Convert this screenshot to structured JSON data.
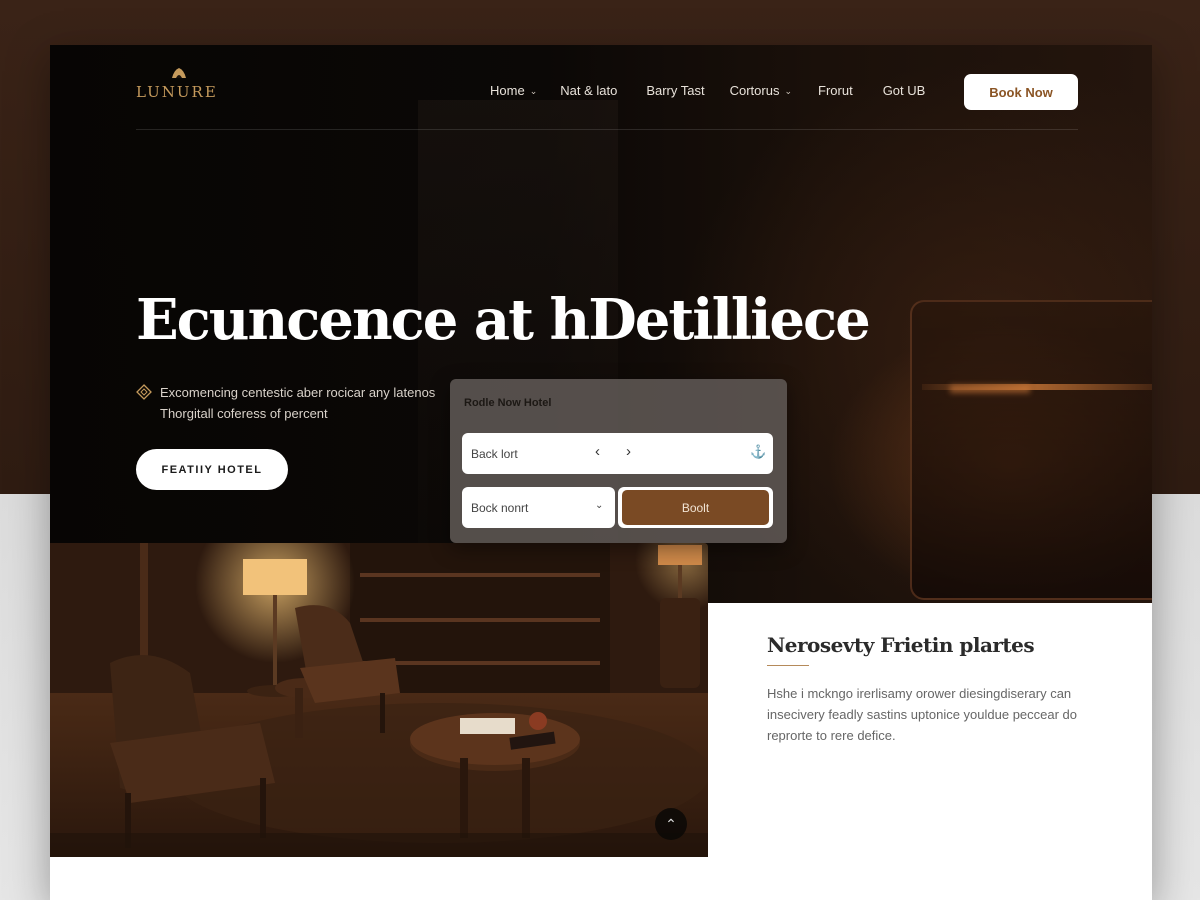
{
  "brand": {
    "name": "LUNURE",
    "accent": "#c59a5c"
  },
  "nav": {
    "items": [
      {
        "label": "Home",
        "has_dropdown": true
      },
      {
        "label": "Nat & lato",
        "has_dropdown": false
      },
      {
        "label": "Barry Tast",
        "has_dropdown": false
      },
      {
        "label": "Cortorus",
        "has_dropdown": true
      },
      {
        "label": "Frorut",
        "has_dropdown": false
      },
      {
        "label": "Got UB",
        "has_dropdown": false
      }
    ],
    "cta": "Book Now"
  },
  "hero": {
    "title": "Ecuncence at hDetilliece",
    "subtitle_line1": "Excomencing centestic aber rocicar any latenos",
    "subtitle_line2": "Thorgitall coferess of percent",
    "button": "FEATIIY HOTEL"
  },
  "booking": {
    "title": "Rodle Now Hotel",
    "field1_label": "Back lort",
    "prev_icon": "‹",
    "next_icon": "›",
    "anchor_icon": "⚓",
    "field2_label": "Bock nonrt",
    "submit": "Boolt",
    "submit_color": "#7a4a24"
  },
  "info": {
    "title": "Nerosevty Frietin plartes",
    "body": "Hshe i mckngo irerlisamy orower diesingdiserary can insecivery feadly sastins uptonice youldue peccear do reprorte to rere defice."
  },
  "colors": {
    "dark_bg": "#0b0806",
    "brown": "#7a4a24",
    "page_bg": "#3a2317"
  }
}
